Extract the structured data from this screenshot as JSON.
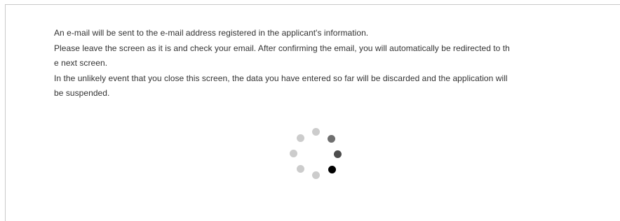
{
  "notice": {
    "lines": [
      "An e-mail will be sent to the e-mail address registered in the applicant's information.",
      "Please leave the screen as it is and check your email. After confirming the email, you will automatically be redirected to th",
      "e next screen.",
      "In the unlikely event that you close this screen, the data you have entered so far will be discarded and the application will",
      "be suspended."
    ]
  },
  "spinner": {
    "icon": "loading-spinner-icon",
    "dot_colors": [
      "#000000",
      "#4d4d4d",
      "#6f6f6f",
      "#cccccc",
      "#cccccc",
      "#cccccc",
      "#cccccc",
      "#cccccc"
    ]
  }
}
